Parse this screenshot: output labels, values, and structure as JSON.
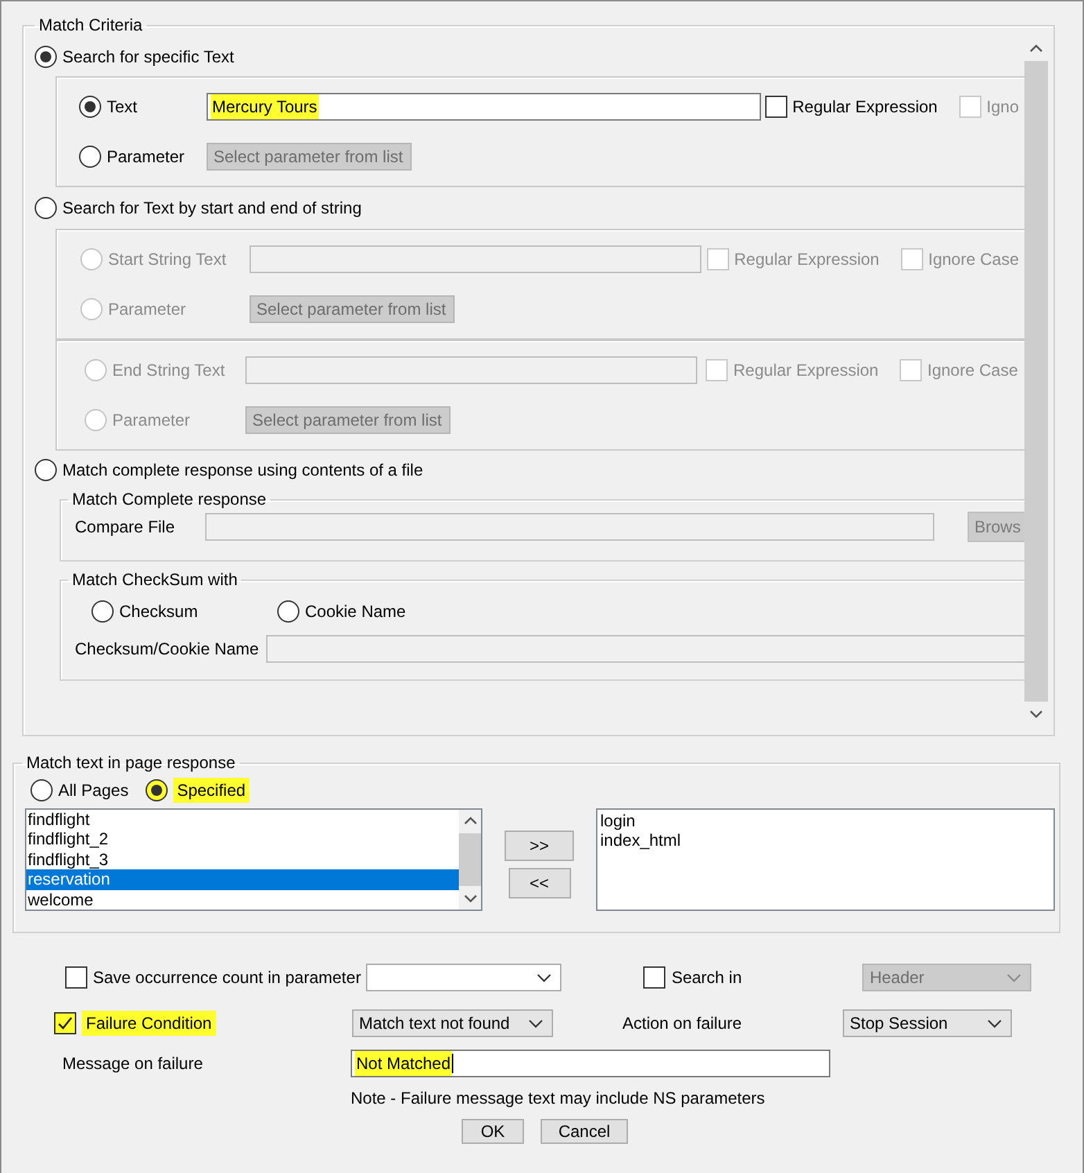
{
  "match_criteria": {
    "title": "Match Criteria",
    "modes": [
      {
        "label": "Search for specific Text",
        "selected": true
      },
      {
        "label": "Search for Text by start and end of string",
        "selected": false
      },
      {
        "label": "Match complete response using contents of a file",
        "selected": false
      }
    ],
    "specific_text": {
      "text_option": {
        "label": "Text",
        "selected": true,
        "disabled": false
      },
      "value": "Mercury Tours",
      "highlighted": true,
      "checkboxes": [
        {
          "label": "Regular Expression",
          "checked": false,
          "disabled": false
        },
        {
          "label": "Igno",
          "checked": false,
          "disabled": true
        }
      ],
      "parameter_option": {
        "label": "Parameter",
        "selected": false,
        "disabled": false
      },
      "parameter_dropdown": {
        "value": "Select parameter from list",
        "disabled": true
      }
    },
    "start_string": {
      "text_option": {
        "label": "Start String Text",
        "selected": false,
        "disabled": true
      },
      "checkboxes": [
        {
          "label": "Regular Expression",
          "checked": false,
          "disabled": true
        },
        {
          "label": "Ignore Case",
          "checked": false,
          "disabled": true
        }
      ],
      "parameter_option": {
        "label": "Parameter",
        "selected": false,
        "disabled": true
      },
      "parameter_dropdown": {
        "value": "Select parameter from list",
        "disabled": true
      }
    },
    "end_string": {
      "text_option": {
        "label": "End String Text",
        "selected": false,
        "disabled": true
      },
      "checkboxes": [
        {
          "label": "Regular Expression",
          "checked": false,
          "disabled": true
        },
        {
          "label": "Ignore Case",
          "checked": false,
          "disabled": true
        }
      ],
      "parameter_option": {
        "label": "Parameter",
        "selected": false,
        "disabled": true
      },
      "parameter_dropdown": {
        "value": "Select parameter from list",
        "disabled": true
      }
    },
    "complete_response": {
      "title": "Match Complete response",
      "compare_label": "Compare File",
      "browse_button": "Brows"
    },
    "checksum": {
      "title": "Match CheckSum with",
      "options": [
        {
          "label": "Checksum",
          "selected": false
        },
        {
          "label": "Cookie Name",
          "selected": false
        }
      ],
      "field_label": "Checksum/Cookie Name"
    }
  },
  "page_response": {
    "title": "Match text in page response",
    "options": [
      {
        "label": "All Pages",
        "selected": false,
        "highlighted": false
      },
      {
        "label": "Specified",
        "selected": true,
        "highlighted": true
      }
    ],
    "available_pages": [
      {
        "label": "findflight",
        "selected": false
      },
      {
        "label": "findflight_2",
        "selected": false
      },
      {
        "label": "findflight_3",
        "selected": false
      },
      {
        "label": "reservation",
        "selected": true
      },
      {
        "label": "welcome",
        "selected": false
      }
    ],
    "add_button": ">>",
    "remove_button": "<<",
    "selected_pages": [
      "login",
      "index_html"
    ]
  },
  "options": {
    "save_count": {
      "label": "Save occurrence count in parameter",
      "checked": false
    },
    "search_in": {
      "label": "Search in",
      "checked": false
    },
    "search_in_dropdown": {
      "value": "Header",
      "disabled": true
    },
    "failure_condition": {
      "label": "Failure Condition",
      "checked": true,
      "highlighted": true
    },
    "failure_dropdown": {
      "value": "Match text not found"
    },
    "action_label": "Action on failure",
    "action_dropdown": {
      "value": "Stop Session"
    },
    "message_label": "Message on failure",
    "message_value": "Not Matched",
    "message_highlighted": true,
    "note": "Note - Failure message text may include NS parameters"
  },
  "buttons": [
    "OK",
    "Cancel"
  ]
}
